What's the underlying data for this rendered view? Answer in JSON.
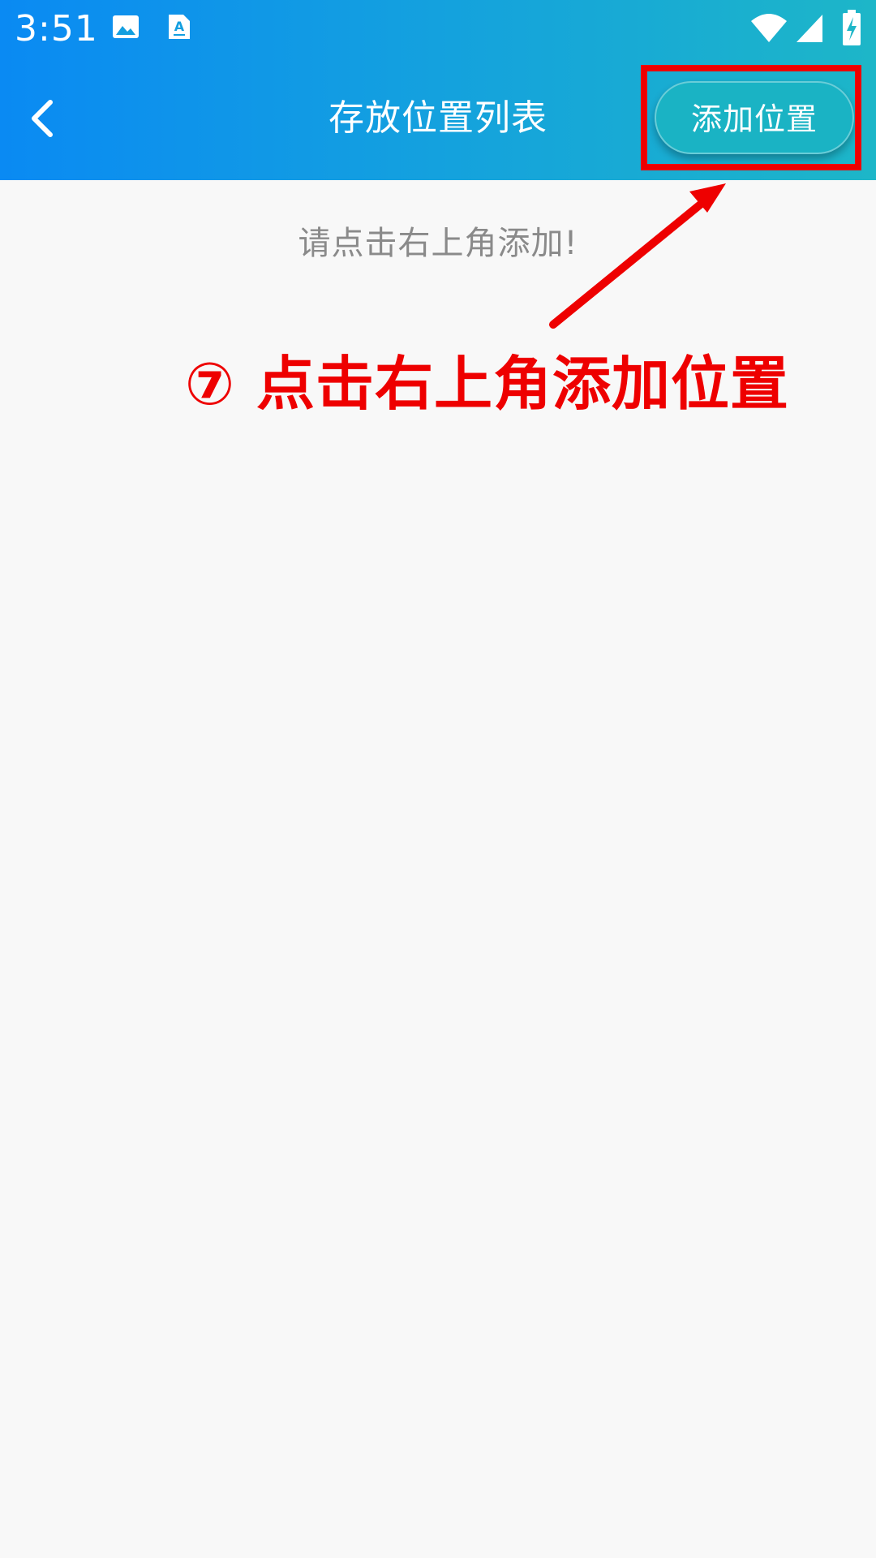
{
  "status_bar": {
    "time": "3:51",
    "icons": [
      "image-icon",
      "text-a-icon",
      "wifi-icon",
      "signal-icon",
      "battery-charging-icon"
    ]
  },
  "toolbar": {
    "back_icon": "chevron-left-icon",
    "title": "存放位置列表",
    "add_button_label": "添加位置"
  },
  "content": {
    "empty_hint": "请点击右上角添加!"
  },
  "annotation": {
    "text": "⑦ 点击右上角添加位置",
    "color": "#ee0000"
  },
  "colors": {
    "header_gradient_start": "#0a8af3",
    "header_gradient_end": "#1db6c8",
    "background": "#f8f8f8",
    "hint_text": "#8a8a8a"
  }
}
